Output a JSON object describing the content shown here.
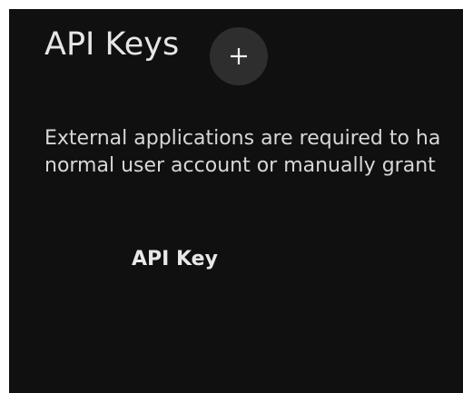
{
  "page": {
    "title": "API Keys",
    "add_button_label": "+"
  },
  "description": {
    "line1": "External applications are required to ha",
    "line2": "normal user account or manually grant"
  },
  "table": {
    "columns": [
      "API Key"
    ]
  },
  "colors": {
    "background": "#101010",
    "button_bg": "#2e2e2e",
    "text": "#e6e6e6"
  },
  "icons": {
    "add": "plus-icon"
  }
}
